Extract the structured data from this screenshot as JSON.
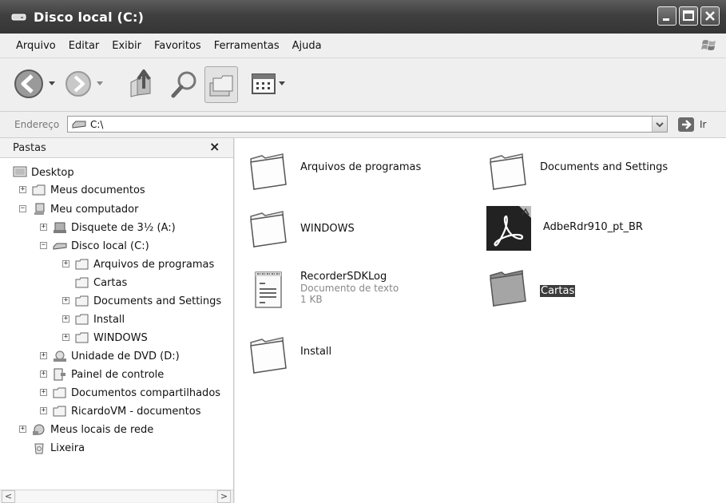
{
  "window": {
    "title": "Disco local (C:)"
  },
  "menu": [
    "Arquivo",
    "Editar",
    "Exibir",
    "Favoritos",
    "Ferramentas",
    "Ajuda"
  ],
  "address": {
    "label": "Endereço",
    "path": "C:\\",
    "go_label": "Ir"
  },
  "folders_pane": {
    "title": "Pastas",
    "close_glyph": "×",
    "tree": [
      {
        "label": "Desktop"
      },
      {
        "label": "Meus documentos"
      },
      {
        "label": "Meu computador"
      },
      {
        "label": "Disquete de 3½ (A:)"
      },
      {
        "label": "Disco local (C:)"
      },
      {
        "label": "Arquivos de programas"
      },
      {
        "label": "Cartas"
      },
      {
        "label": "Documents and Settings"
      },
      {
        "label": "Install"
      },
      {
        "label": "WINDOWS"
      },
      {
        "label": "Unidade de DVD (D:)"
      },
      {
        "label": "Painel de controle"
      },
      {
        "label": "Documentos compartilhados"
      },
      {
        "label": "RicardoVM - documentos"
      },
      {
        "label": "Meus locais de rede"
      },
      {
        "label": "Lixeira"
      }
    ]
  },
  "content": {
    "items": [
      {
        "name": "Arquivos de programas",
        "icon": "folder-icon"
      },
      {
        "name": "Documents and Settings",
        "icon": "folder-icon"
      },
      {
        "name": "WINDOWS",
        "icon": "folder-icon"
      },
      {
        "name": "AdbeRdr910_pt_BR",
        "icon": "acrobat-icon"
      },
      {
        "name": "RecorderSDKLog",
        "type": "Documento de texto",
        "size": "1 KB",
        "icon": "text-document-icon"
      },
      {
        "name": "Cartas",
        "icon": "folder-icon",
        "selected": true
      },
      {
        "name": "Install",
        "icon": "folder-icon"
      }
    ]
  }
}
